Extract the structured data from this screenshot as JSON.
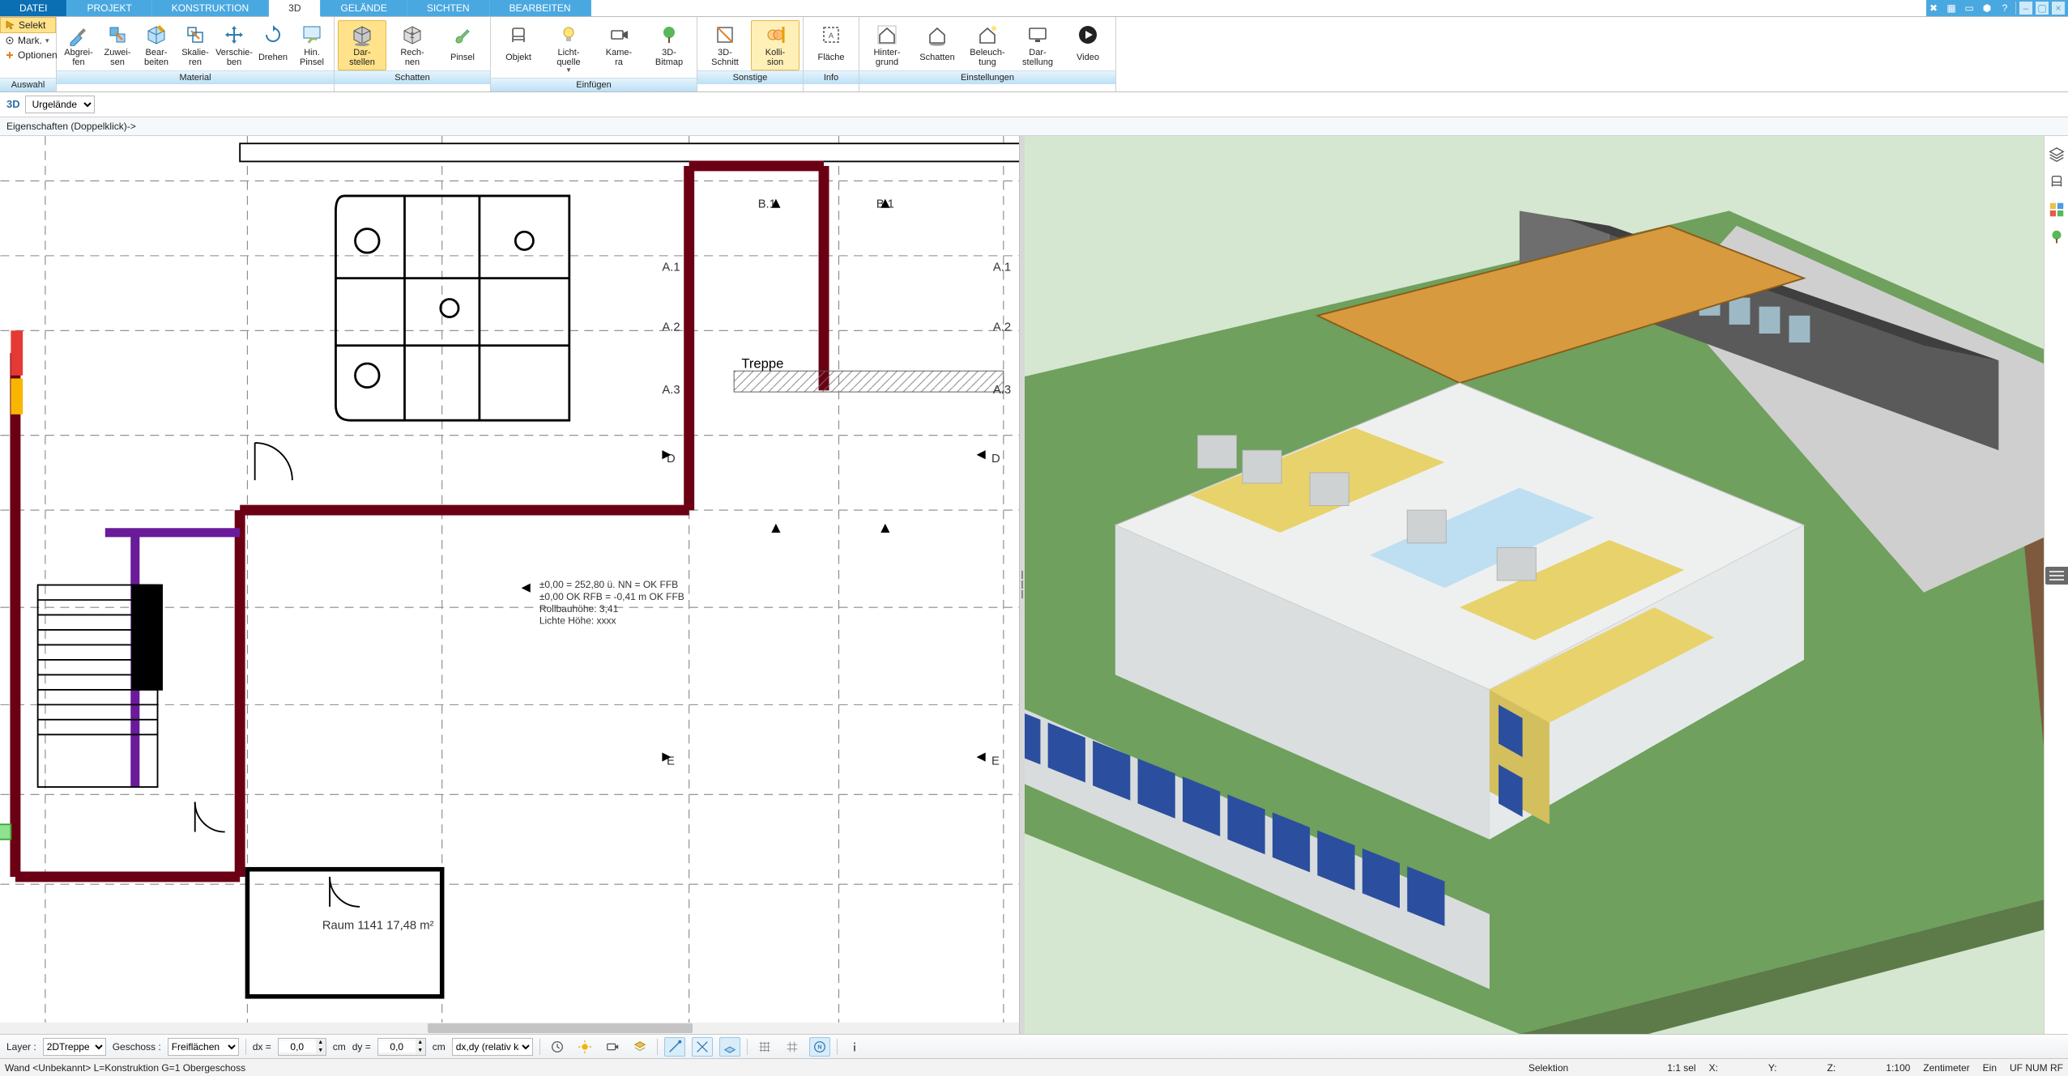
{
  "menu": {
    "tabs": [
      "DATEI",
      "PROJEKT",
      "KONSTRUKTION",
      "3D",
      "GELÄNDE",
      "SICHTEN",
      "BEARBEITEN"
    ],
    "active_index": 3
  },
  "titlebar_icons": [
    "tools",
    "tile",
    "cascade",
    "virus",
    "help"
  ],
  "side_panel": {
    "select": "Selekt",
    "mark": "Mark.",
    "options": "Optionen",
    "group": "Auswahl"
  },
  "ribbon": {
    "groups": [
      {
        "name": "Material",
        "tools": [
          {
            "label": "Abgrei-\nfen",
            "icon": "eyedrop"
          },
          {
            "label": "Zuwei-\nsen",
            "icon": "assign"
          },
          {
            "label": "Bear-\nbeiten",
            "icon": "edit-cube"
          },
          {
            "label": "Skalie-\nren",
            "icon": "scale"
          },
          {
            "label": "Verschie-\nben",
            "icon": "move"
          },
          {
            "label": "Drehen",
            "icon": "rotate"
          },
          {
            "label": "Hin.\nPinsel",
            "icon": "brush-bg"
          }
        ]
      },
      {
        "name": "Schatten",
        "tools": [
          {
            "label": "Dar-\nstellen",
            "icon": "cube-shadow",
            "active": true
          },
          {
            "label": "Rech-\nnen",
            "icon": "cube-calc"
          },
          {
            "label": "Pinsel",
            "icon": "brush"
          }
        ]
      },
      {
        "name": "Einfügen",
        "tools": [
          {
            "label": "Objekt",
            "icon": "chair"
          },
          {
            "label": "Licht-\nquelle",
            "icon": "bulb",
            "caret": true
          },
          {
            "label": "Kame-\nra",
            "icon": "camera"
          },
          {
            "label": "3D-\nBitmap",
            "icon": "tree"
          }
        ]
      },
      {
        "name": "Sonstige",
        "tools": [
          {
            "label": "3D-\nSchnitt",
            "icon": "section"
          },
          {
            "label": "Kolli-\nsion",
            "icon": "collision",
            "active2": true
          }
        ]
      },
      {
        "name": "Info",
        "tools": [
          {
            "label": "Fläche",
            "icon": "area"
          }
        ]
      },
      {
        "name": "Einstellungen",
        "tools": [
          {
            "label": "Hinter-\ngrund",
            "icon": "house-bg"
          },
          {
            "label": "Schatten",
            "icon": "house-shadow"
          },
          {
            "label": "Beleuch-\ntung",
            "icon": "house-light"
          },
          {
            "label": "Dar-\nstellung",
            "icon": "monitor"
          },
          {
            "label": "Video",
            "icon": "play"
          }
        ]
      }
    ]
  },
  "subbar": {
    "badge": "3D",
    "dropdown": "Urgelände",
    "props_hint": "Eigenschaften (Doppelklick)->"
  },
  "plan2d": {
    "labels": {
      "treppe": "Treppe",
      "a1": "A.1",
      "a2": "A.2",
      "a3": "A.3",
      "b1": "B.1",
      "d": "D",
      "e": "E"
    },
    "note_lines": [
      "±0,00 = 252,80 ü. NN = OK FFB",
      "±0,00 OK RFB = -0,41 m OK FFB",
      "Rollbauhöhe: 3,41",
      "Lichte Höhe: xxxx"
    ],
    "room_label": "Raum 1141\n17,48 m²"
  },
  "toolbar": {
    "layer_lbl": "Layer :",
    "layer_val": "2DTreppe",
    "floor_lbl": "Geschoss :",
    "floor_val": "Freiflächen",
    "dx_lbl": "dx =",
    "dx_val": "0,0",
    "dx_unit": "cm",
    "dy_lbl": "dy =",
    "dy_val": "0,0",
    "dy_unit": "cm",
    "mode": "dx,dy (relativ ka"
  },
  "status": {
    "left": "Wand  <Unbekannt>  L=Konstruktion  G=1 Obergeschoss",
    "selektion": "Selektion",
    "sel": "1:1 sel",
    "x": "X:",
    "y": "Y:",
    "z": "Z:",
    "scale": "1:100",
    "unit": "Zentimeter",
    "ein": "Ein",
    "flags": "UF  NUM  RF"
  },
  "colors": {
    "accent": "#4aa8e0",
    "accent_dark": "#0a6fb3",
    "highlight": "#ffe28a"
  }
}
